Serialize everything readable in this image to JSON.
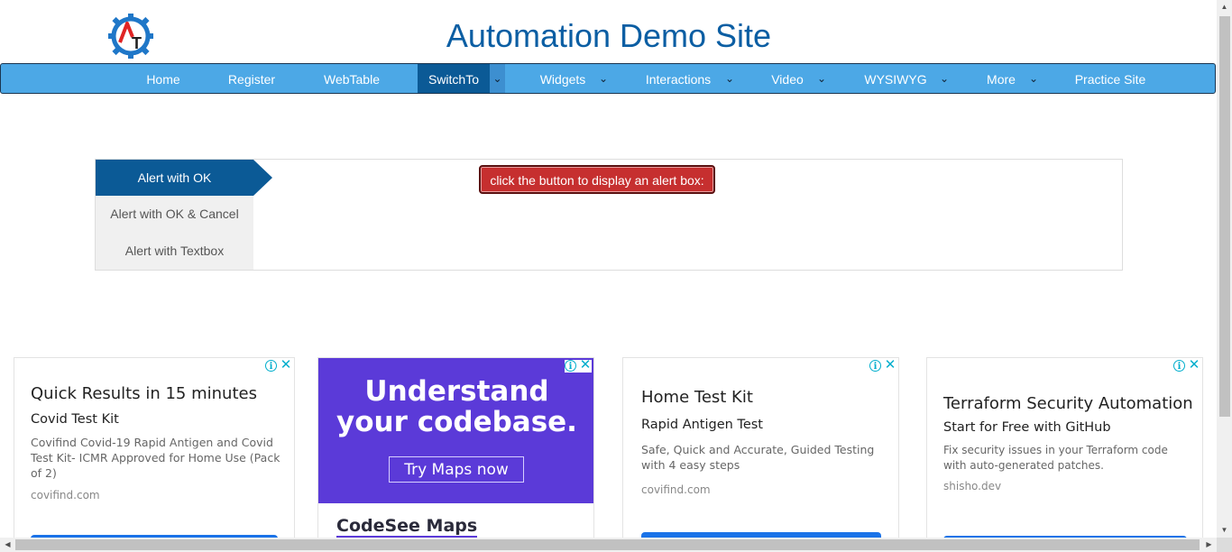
{
  "header": {
    "title": "Automation Demo Site",
    "logo_letters": "AT"
  },
  "nav": {
    "items": [
      {
        "label": "Home"
      },
      {
        "label": "Register"
      },
      {
        "label": "WebTable"
      },
      {
        "label": "SwitchTo"
      },
      {
        "label": "Widgets"
      },
      {
        "label": "Interactions"
      },
      {
        "label": "Video"
      },
      {
        "label": "WYSIWYG"
      },
      {
        "label": "More"
      },
      {
        "label": "Practice Site"
      }
    ],
    "active": "SwitchTo",
    "caret_glyph": "⌄"
  },
  "alerts": {
    "tabs": [
      {
        "label": "Alert with OK"
      },
      {
        "label": "Alert with OK & Cancel"
      },
      {
        "label": "Alert with Textbox"
      }
    ],
    "active_tab": "Alert with OK",
    "button_label": "click the button to display an alert box:"
  },
  "ads": [
    {
      "headline": "Quick Results in 15 minutes",
      "subhead": "Covid Test Kit",
      "body": "Covifind Covid-19 Rapid Antigen and Covid Test Kit- ICMR Approved for Home Use (Pack of 2)",
      "domain": "covifind.com"
    },
    {
      "promo_line1": "Understand",
      "promo_line2": "your codebase.",
      "promo_button": "Try Maps now",
      "brand": "CodeSee Maps"
    },
    {
      "headline": "Home Test Kit",
      "subhead": "Rapid Antigen Test",
      "body": "Safe, Quick and Accurate, Guided Testing with 4 easy steps",
      "domain": "covifind.com"
    },
    {
      "headline": "Terraform Security Automation",
      "subhead": "Start for Free with GitHub",
      "body": "Fix security issues in your Terraform code with auto-generated patches.",
      "domain": "shisho.dev"
    }
  ],
  "ad_controls": {
    "info": "i",
    "close": "✕"
  },
  "colors": {
    "nav_bg": "#4ca8e6",
    "nav_active": "#0b5a96",
    "title": "#0b5ea3",
    "alert_button": "#c62f2f",
    "promo_bg": "#5b3ad8",
    "ad_icon": "#00aecd"
  }
}
